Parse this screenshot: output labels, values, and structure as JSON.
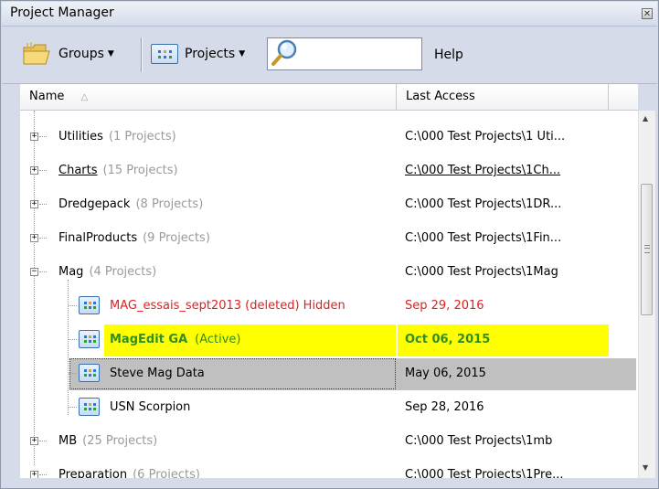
{
  "window": {
    "title": "Project Manager",
    "close_glyph": "✕"
  },
  "toolbar": {
    "groups_label": "Groups",
    "projects_label": "Projects",
    "search": {
      "value": ""
    },
    "help_label": "Help"
  },
  "columns": {
    "name": "Name",
    "last_access": "Last Access",
    "sort_glyph": "△"
  },
  "rows": [
    {
      "kind": "group",
      "expander": "+",
      "label": "Utilities",
      "count": "(1 Projects)",
      "access": "C:\\000 Test Projects\\1 Uti..."
    },
    {
      "kind": "group",
      "expander": "+",
      "label": "Charts",
      "count": "(15 Projects)",
      "access": "C:\\000 Test Projects\\1Ch...",
      "hover": true
    },
    {
      "kind": "group",
      "expander": "+",
      "label": "Dredgepack",
      "count": "(8 Projects)",
      "access": "C:\\000 Test Projects\\1DR..."
    },
    {
      "kind": "group",
      "expander": "+",
      "label": "FinalProducts",
      "count": "(9 Projects)",
      "access": "C:\\000 Test Projects\\1Fin..."
    },
    {
      "kind": "group",
      "expander": "−",
      "label": "Mag",
      "count": "(4 Projects)",
      "access": "C:\\000 Test Projects\\1Mag"
    },
    {
      "kind": "project",
      "label": "MAG_essais_sept2013 (deleted)  Hidden",
      "access": "Sep 29, 2016",
      "state": "deleted"
    },
    {
      "kind": "project",
      "label": "MagEdit GA",
      "status": "(Active)",
      "access": "Oct 06, 2015",
      "state": "active"
    },
    {
      "kind": "project",
      "label": "Steve Mag Data",
      "access": "May 06, 2015",
      "state": "selected"
    },
    {
      "kind": "project",
      "label": "USN Scorpion",
      "access": "Sep 28, 2016",
      "state": "normal"
    },
    {
      "kind": "group",
      "expander": "+",
      "label": "MB",
      "count": "(25 Projects)",
      "access": "C:\\000 Test Projects\\1mb"
    },
    {
      "kind": "group",
      "expander": "+",
      "label": "Preparation",
      "count": "(6 Projects)",
      "access": "C:\\000 Test Projects\\1Pre...",
      "hover": true
    }
  ],
  "colors": {
    "deleted_red": "#e02020",
    "active_green": "#2f8f1f",
    "active_highlight": "#ffff00",
    "selected_bg": "#c0c0c0"
  },
  "icons": [
    "folder-icon",
    "projects-grid-icon",
    "magnifier-icon",
    "expand-icon",
    "collapse-icon",
    "project-icon"
  ]
}
